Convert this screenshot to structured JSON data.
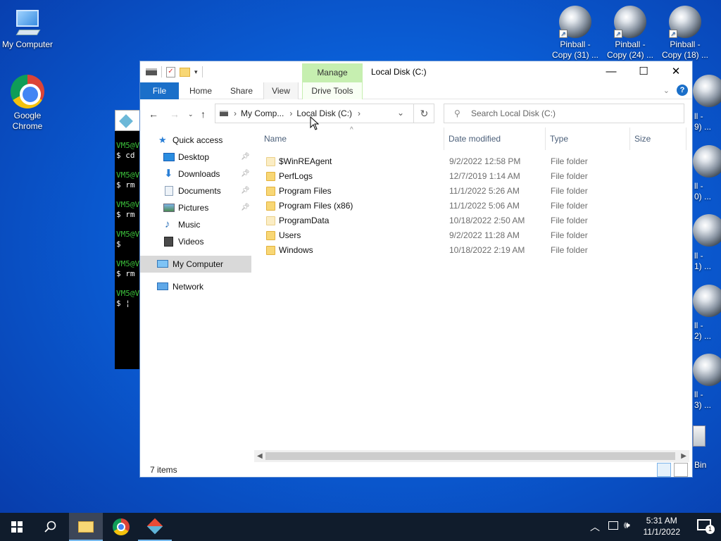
{
  "desktop": {
    "my_computer": "My Computer",
    "chrome": "Google\nChrome",
    "pinball": [
      {
        "l1": "Pinball -",
        "l2": "Copy (31) ..."
      },
      {
        "l1": "Pinball -",
        "l2": "Copy (24) ..."
      },
      {
        "l1": "Pinball -",
        "l2": "Copy (18) ..."
      }
    ],
    "right_fragments": [
      "ll -",
      "9) ...",
      "ll -",
      "0) ...",
      "ll -",
      "1) ...",
      "ll -",
      "2) ...",
      "ll -",
      "3) ...",
      "Bin"
    ]
  },
  "terminal": {
    "lines": [
      {
        "g": "VM5@V",
        "t": ""
      },
      {
        "g": "",
        "t": "$ cd"
      },
      {
        "g": "VM5@V",
        "t": ""
      },
      {
        "g": "",
        "t": "$ rm"
      },
      {
        "g": "VM5@V",
        "t": ""
      },
      {
        "g": "",
        "t": "$ rm"
      },
      {
        "g": "VM5@V",
        "t": ""
      },
      {
        "g": "",
        "t": "$"
      },
      {
        "g": "VM5@V",
        "t": ""
      },
      {
        "g": "",
        "t": "$ rm"
      },
      {
        "g": "VM5@V",
        "t": ""
      },
      {
        "g": "",
        "t": "$ ¦"
      }
    ]
  },
  "explorer": {
    "title": "Local Disk (C:)",
    "manage": "Manage",
    "tabs": {
      "file": "File",
      "home": "Home",
      "share": "Share",
      "view": "View",
      "drive_tools": "Drive Tools"
    },
    "address": {
      "seg1": "My Comp...",
      "seg2": "Local Disk (C:)"
    },
    "search_placeholder": "Search Local Disk (C:)",
    "nav": {
      "quick_access": "Quick access",
      "desktop": "Desktop",
      "downloads": "Downloads",
      "documents": "Documents",
      "pictures": "Pictures",
      "music": "Music",
      "videos": "Videos",
      "my_computer": "My Computer",
      "network": "Network"
    },
    "columns": {
      "name": "Name",
      "date": "Date modified",
      "type": "Type",
      "size": "Size"
    },
    "rows": [
      {
        "name": "$WinREAgent",
        "date": "9/2/2022 12:58 PM",
        "type": "File folder"
      },
      {
        "name": "PerfLogs",
        "date": "12/7/2019 1:14 AM",
        "type": "File folder"
      },
      {
        "name": "Program Files",
        "date": "11/1/2022 5:26 AM",
        "type": "File folder"
      },
      {
        "name": "Program Files (x86)",
        "date": "11/1/2022 5:06 AM",
        "type": "File folder"
      },
      {
        "name": "ProgramData",
        "date": "10/18/2022 2:50 AM",
        "type": "File folder"
      },
      {
        "name": "Users",
        "date": "9/2/2022 11:28 AM",
        "type": "File folder"
      },
      {
        "name": "Windows",
        "date": "10/18/2022 2:19 AM",
        "type": "File folder"
      }
    ],
    "status": "7 items"
  },
  "taskbar": {
    "time": "5:31 AM",
    "date": "11/1/2022",
    "notification_count": "1"
  }
}
